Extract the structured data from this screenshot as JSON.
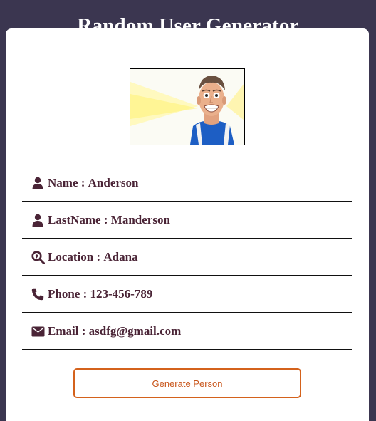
{
  "header": {
    "title": "Random User Generator"
  },
  "profile": {
    "photo_alt": "person photo",
    "fields": [
      {
        "icon": "user-icon",
        "label": "Name",
        "value": "Anderson"
      },
      {
        "icon": "user-icon",
        "label": "LastName",
        "value": "Manderson"
      },
      {
        "icon": "search-location-icon",
        "label": "Location",
        "value": "Adana"
      },
      {
        "icon": "phone-icon",
        "label": "Phone",
        "value": "123-456-789"
      },
      {
        "icon": "envelope-icon",
        "label": "Email",
        "value": "asdfg@gmail.com"
      }
    ],
    "separator": " : "
  },
  "actions": {
    "generate_label": "Generate Person"
  },
  "colors": {
    "background": "#3b3650",
    "card": "#ffffff",
    "text": "#4a2436",
    "button_border": "#d4621c",
    "button_text": "#c8551a"
  }
}
